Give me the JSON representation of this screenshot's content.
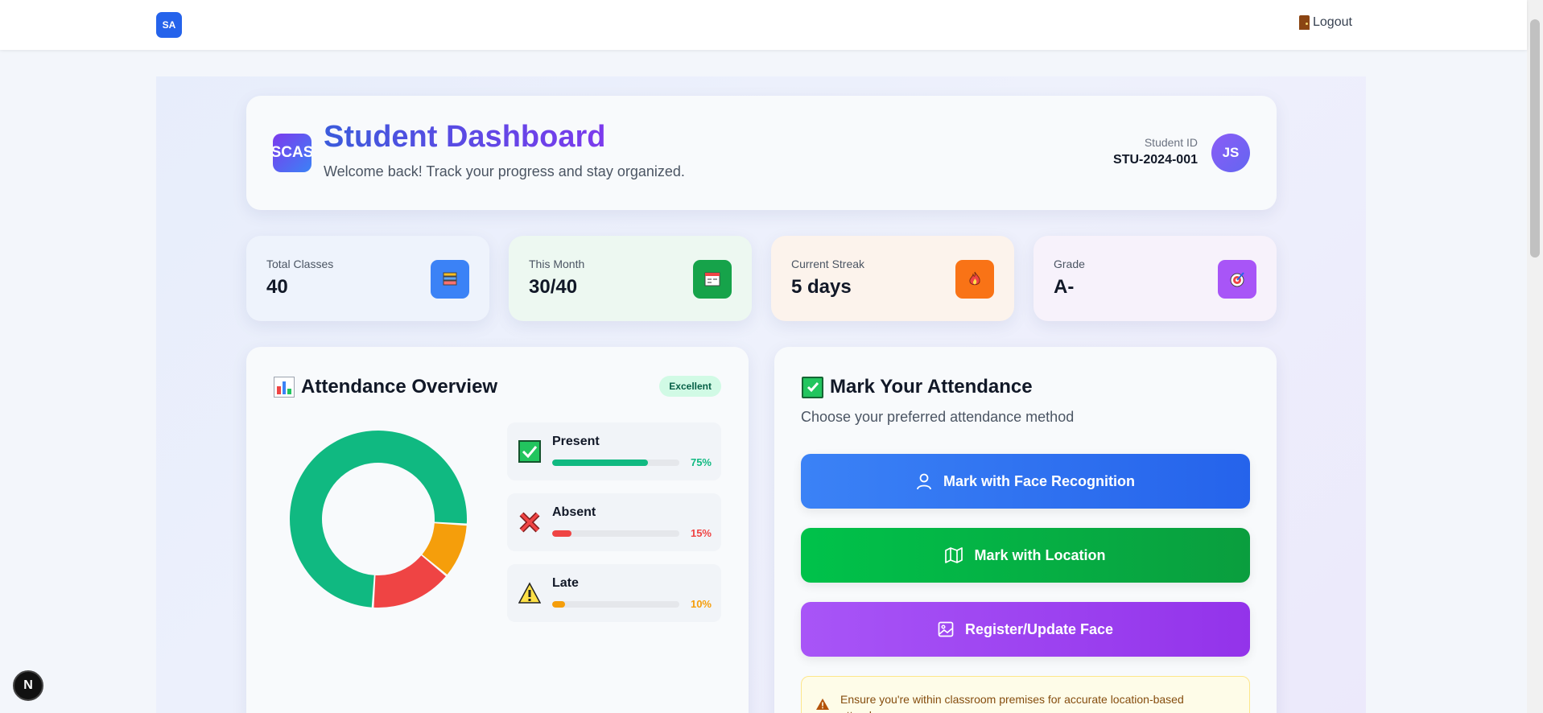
{
  "topbar": {
    "logo": "SA",
    "logout_label": "Logout"
  },
  "header": {
    "logo": "SCAS",
    "title": "Student Dashboard",
    "subtitle": "Welcome back! Track your progress and stay organized.",
    "student_id_label": "Student ID",
    "student_id": "STU-2024-001",
    "avatar_initials": "JS"
  },
  "stats": [
    {
      "label": "Total Classes",
      "value": "40",
      "icon": "books-icon"
    },
    {
      "label": "This Month",
      "value": "30/40",
      "icon": "calendar-icon"
    },
    {
      "label": "Current Streak",
      "value": "5 days",
      "icon": "fire-icon"
    },
    {
      "label": "Grade",
      "value": "A-",
      "icon": "target-icon"
    }
  ],
  "attendance": {
    "title": "Attendance Overview",
    "badge": "Excellent",
    "items": [
      {
        "name": "Present",
        "percent": "75%",
        "value": 75,
        "color": "#10b981"
      },
      {
        "name": "Absent",
        "percent": "15%",
        "value": 15,
        "color": "#ef4444"
      },
      {
        "name": "Late",
        "percent": "10%",
        "value": 10,
        "color": "#f59e0b"
      }
    ]
  },
  "mark": {
    "title": "Mark Your Attendance",
    "subtitle": "Choose your preferred attendance method",
    "face_button": "Mark with Face Recognition",
    "location_button": "Mark with Location",
    "register_button": "Register/Update Face",
    "warning": "Ensure you're within classroom premises for accurate location-based attendance."
  },
  "next_badge": "N"
}
